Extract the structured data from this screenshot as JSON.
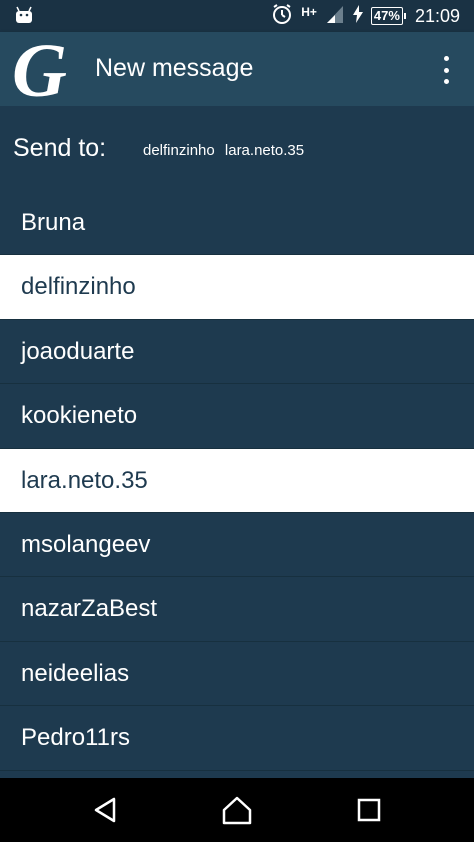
{
  "status_bar": {
    "network": "H+",
    "battery": "47%",
    "time": "21:09"
  },
  "app_bar": {
    "logo_letter": "G",
    "title": "New message"
  },
  "send_to": {
    "label": "Send to:",
    "recipients": [
      "delfinzinho",
      "lara.neto.35"
    ]
  },
  "contacts": [
    {
      "name": "Bruna",
      "selected": false
    },
    {
      "name": "delfinzinho",
      "selected": true
    },
    {
      "name": "joaoduarte",
      "selected": false
    },
    {
      "name": "kookieneto",
      "selected": false
    },
    {
      "name": "lara.neto.35",
      "selected": true
    },
    {
      "name": "msolangeev",
      "selected": false
    },
    {
      "name": "nazarZaBest",
      "selected": false
    },
    {
      "name": "neideelias",
      "selected": false
    },
    {
      "name": "Pedro11rs",
      "selected": false
    }
  ],
  "colors": {
    "background": "#1e3a4f",
    "app_bar": "#264a5f",
    "selected_row": "#ffffff"
  }
}
